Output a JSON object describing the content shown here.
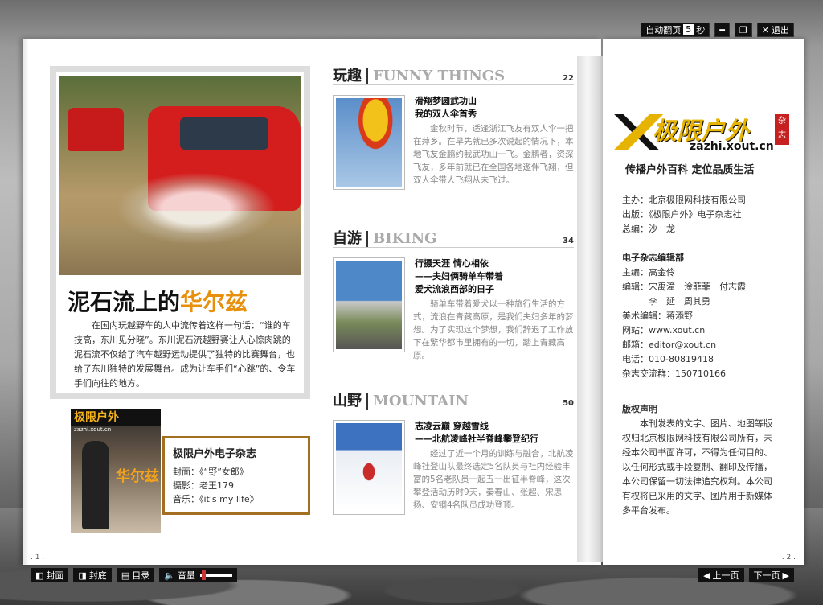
{
  "top_controls": {
    "auto_flip_label": "自动翻页",
    "auto_flip_seconds": "5",
    "seconds_unit": "秒",
    "minimize": "━",
    "restore": "❐",
    "exit_label": "退出"
  },
  "bottom_controls": {
    "front_cover": "封面",
    "back_cover": "封底",
    "toc": "目录",
    "volume": "音量",
    "volume_level": 0.1,
    "prev_page": "上一页",
    "next_page": "下一页"
  },
  "page_numbers": {
    "left": ". 1 .",
    "right": ". 2 ."
  },
  "feature": {
    "title_plain": "泥石流上的",
    "title_highlight": "华尔兹",
    "body": "在国内玩越野车的人中流传着这样一句话：“谁的车技高，东川见分晓”。东川泥石流越野赛让人心惊肉跳的泥石流不仅给了汽车越野运动提供了独特的比赛舞台，也给了东川独特的发展舞台。成为让车手们“心跳”的、令车手们向往的地方。"
  },
  "cover": {
    "masthead": "极限户外",
    "url": "zazhi.xout.cn",
    "headline": "华尔兹"
  },
  "info_box": {
    "title": "极限户外电子杂志",
    "cover_line": "封面：《“野”女郎》",
    "photo_line": "摄影：老王179",
    "music_line": "音乐：《it's my life》"
  },
  "sections": [
    {
      "cn": "玩趣",
      "en": "FUNNY THINGS",
      "page": "22",
      "title1": "滑翔梦圆武功山",
      "title2": "我的双人伞首秀",
      "body": "金秋时节，适逢浙江飞友有双人伞一把在萍乡。在早先就已多次说起的情况下，本地飞友金鹏约我武功山一飞。金鹏者，资深飞友，多年前就已在全国各地遨伴飞翔，但双人伞带人飞翔从未飞过。"
    },
    {
      "cn": "自游",
      "en": "BIKING",
      "page": "34",
      "title1": "行摄天涯  情心相依",
      "title2": "——夫妇俩骑单车带着",
      "title3": "爱犬流浪西部的日子",
      "body": "骑单车带着爱犬以一种旅行生活的方式，流浪在青藏高原，是我们夫妇多年的梦想。为了实现这个梦想，我们辞退了工作放下在繁华都市里拥有的一切，踏上青藏高原。"
    },
    {
      "cn": "山野",
      "en": "MOUNTAIN",
      "page": "50",
      "title1": "志凌云巅  穿越雪线",
      "title2": "——北航凌峰社半脊峰攀登纪行",
      "body": "经过了近一个月的训练与融合，北航凌峰社登山队最终选定5名队员与社内经验丰富的5名老队员一起五一出征半脊峰，这次攀登活动历时9天，秦春山、张超、宋思扬、安钢4名队员成功登顶。"
    }
  ],
  "right_page": {
    "logo_text": "极限户外",
    "logo_tag": "杂志",
    "logo_url": "zazhi.xout.cn",
    "slogan": "传播户外百科  定位品质生活",
    "sponsor": "主办：北京极限网科技有限公司",
    "publisher": "出版：《极限户外》电子杂志社",
    "chief": "总编：沙　龙",
    "editorial_title": "电子杂志编辑部",
    "editor_main": "主编：高金伶",
    "editors": "编辑：宋禹潼　淦菲菲　付志霞",
    "editors2": "　　　李　延　周其勇",
    "art_editor": "美术编辑：蒋添野",
    "website": "网站：www.xout.cn",
    "email": "邮箱：editor@xout.cn",
    "phone": "电话：010-80819418",
    "group": "杂志交流群：150710166",
    "copyright_title": "版权声明",
    "copyright_body": "本刊发表的文字、图片、地图等版权归北京极限网科技有限公司所有，未经本公司书面许可，不得为任何目的、以任何形式或手段复制、翻印及传播，本公司保留一切法律追究权利。本公司有权将已采用的文字、图片用于新媒体多平台发布。"
  },
  "colors": {
    "accent": "#e8900c",
    "frame": "#a37022",
    "logo_yellow": "#e6b300"
  }
}
